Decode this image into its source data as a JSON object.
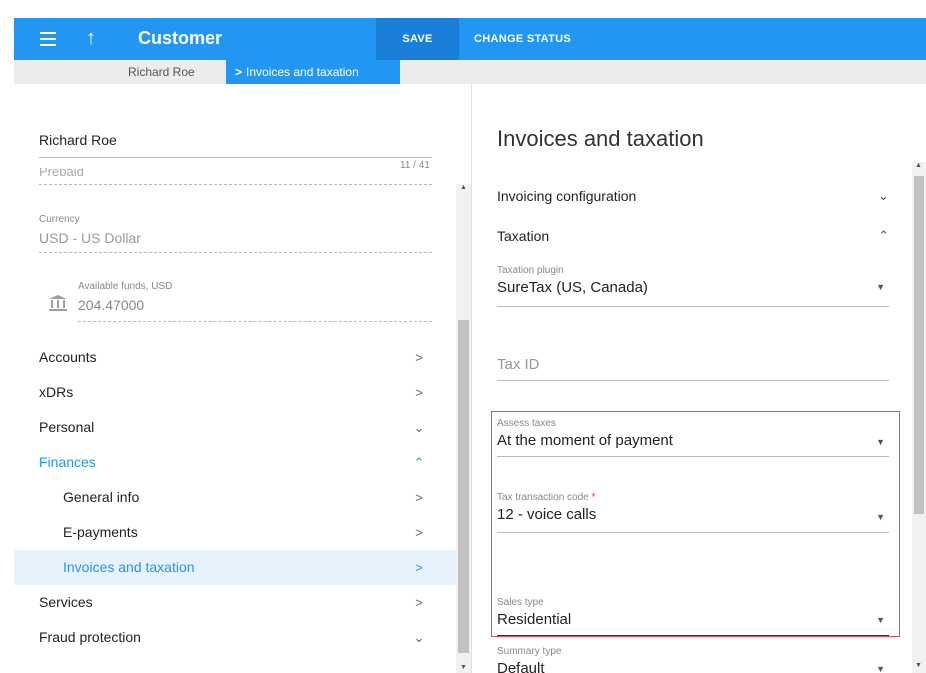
{
  "header": {
    "title": "Customer",
    "save_label": "SAVE",
    "change_status_label": "CHANGE STATUS"
  },
  "breadcrumb": {
    "parent": "Richard Roe",
    "current": "Invoices and taxation"
  },
  "left": {
    "name": "Richard Roe",
    "name_counter": "11 / 41",
    "prepaid_cut": "Prepaid",
    "currency_label": "Currency",
    "currency_value": "USD - US Dollar",
    "funds_label": "Available funds, USD",
    "funds_value": "204.47000",
    "nav": [
      {
        "label": "Accounts",
        "icon": "chevron-right"
      },
      {
        "label": "xDRs",
        "icon": "chevron-right"
      },
      {
        "label": "Personal",
        "icon": "chevron-down"
      },
      {
        "label": "Finances",
        "icon": "chevron-up"
      },
      {
        "label": "General info",
        "icon": "chevron-right"
      },
      {
        "label": "E-payments",
        "icon": "chevron-right"
      },
      {
        "label": "Invoices and taxation",
        "icon": "chevron-right"
      },
      {
        "label": "Services",
        "icon": "chevron-right"
      },
      {
        "label": "Fraud protection",
        "icon": "chevron-down"
      }
    ]
  },
  "right": {
    "title": "Invoices and taxation",
    "sections": {
      "invoicing": "Invoicing configuration",
      "taxation": "Taxation"
    },
    "fields": {
      "taxation_plugin_label": "Taxation plugin",
      "taxation_plugin_value": "SureTax (US, Canada)",
      "tax_id_placeholder": "Tax ID",
      "assess_taxes_label": "Assess taxes",
      "assess_taxes_value": "At the moment of payment",
      "tax_code_label": "Tax transaction code",
      "tax_code_required": "*",
      "tax_code_value": "12 - voice calls",
      "sales_type_label": "Sales type",
      "sales_type_value": "Residential",
      "summary_type_label": "Summary type",
      "summary_type_value": "Default"
    }
  },
  "colors": {
    "accent": "#2196f3",
    "save_button": "#1a7fd9",
    "highlight_border": "#d9534f",
    "required": "#e53935"
  }
}
